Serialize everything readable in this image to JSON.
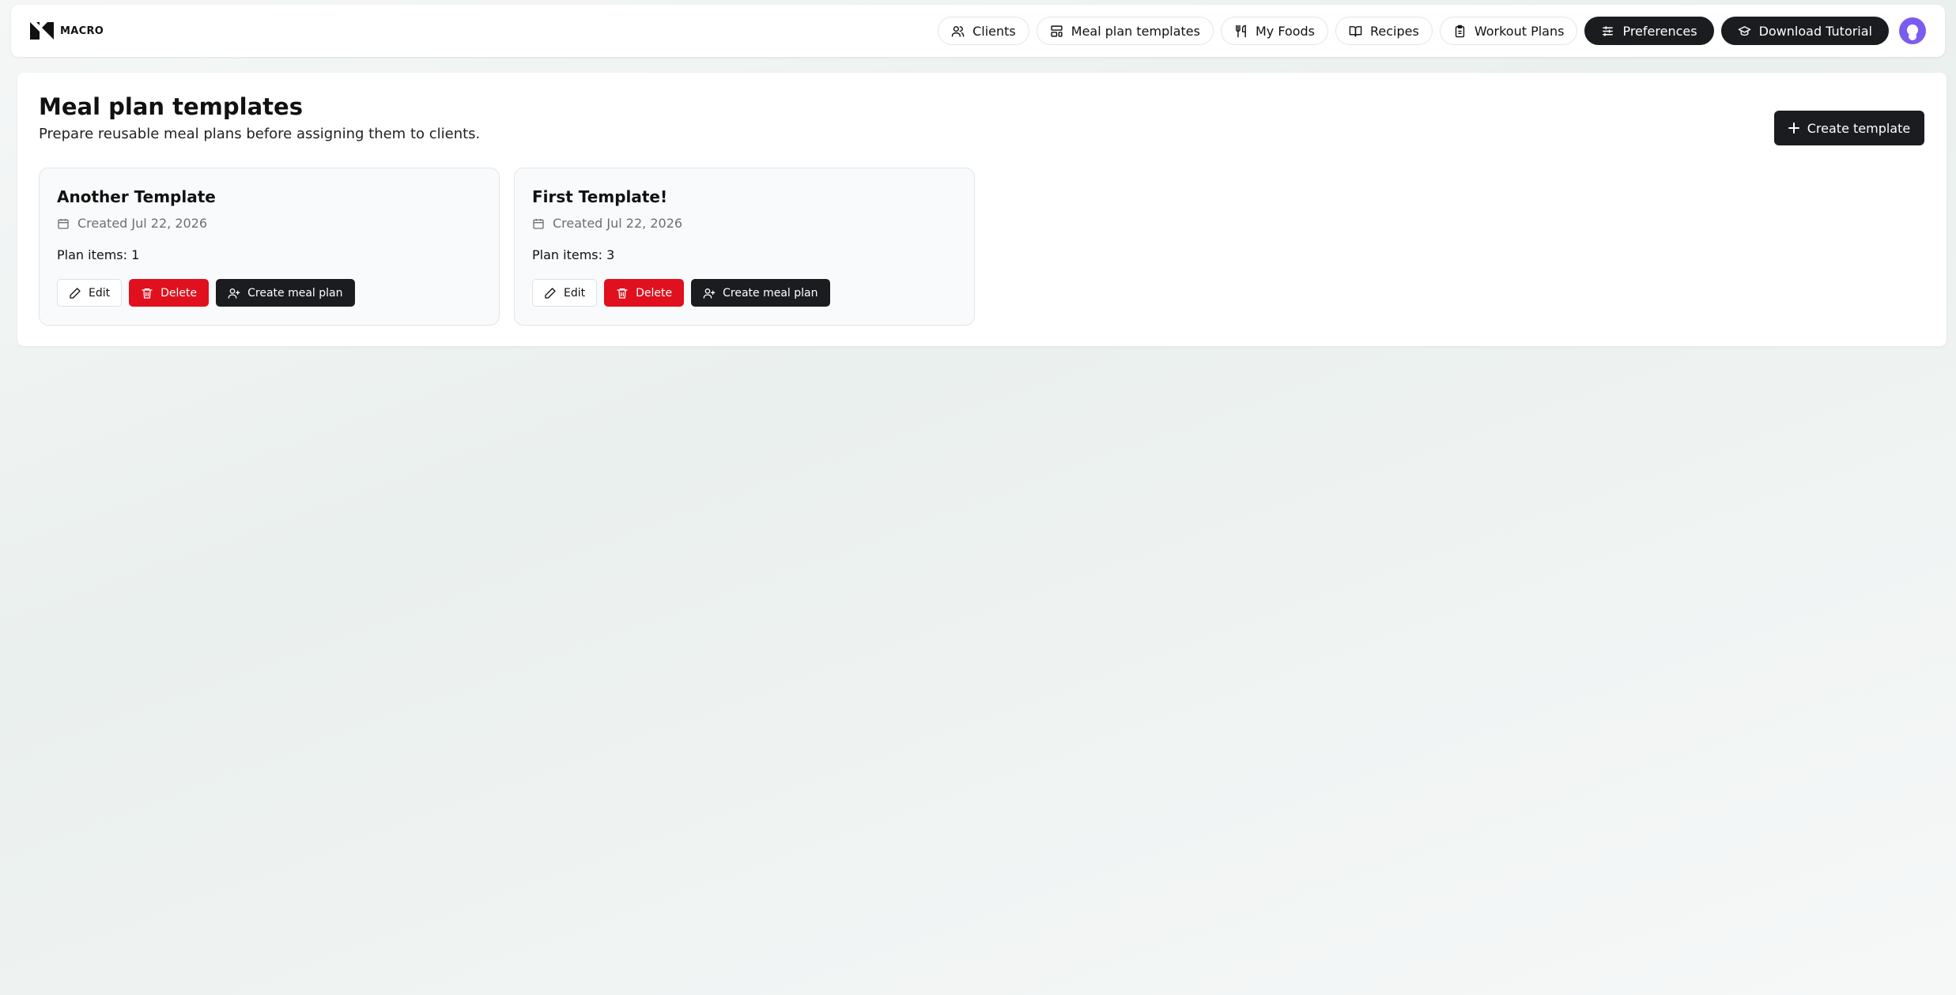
{
  "brand": {
    "name": "MACRO"
  },
  "nav": {
    "clients": "Clients",
    "meal_plan_templates": "Meal plan templates",
    "my_foods": "My Foods",
    "recipes": "Recipes",
    "workout_plans": "Workout Plans",
    "preferences": "Preferences",
    "download_tutorial": "Download Tutorial"
  },
  "page": {
    "title": "Meal plan templates",
    "subtitle": "Prepare reusable meal plans before assigning them to clients.",
    "create_button": "Create template"
  },
  "templates": [
    {
      "title": "Another Template",
      "created": "Created Jul 22, 2026",
      "items": "Plan items: 1",
      "edit": "Edit",
      "delete": "Delete",
      "create_meal_plan": "Create meal plan"
    },
    {
      "title": "First Template!",
      "created": "Created Jul 22, 2026",
      "items": "Plan items: 3",
      "edit": "Edit",
      "delete": "Delete",
      "create_meal_plan": "Create meal plan"
    }
  ],
  "colors": {
    "dark_button": "#1b1c1f",
    "delete_button": "#e0101e",
    "avatar": "#7b5cf0"
  }
}
